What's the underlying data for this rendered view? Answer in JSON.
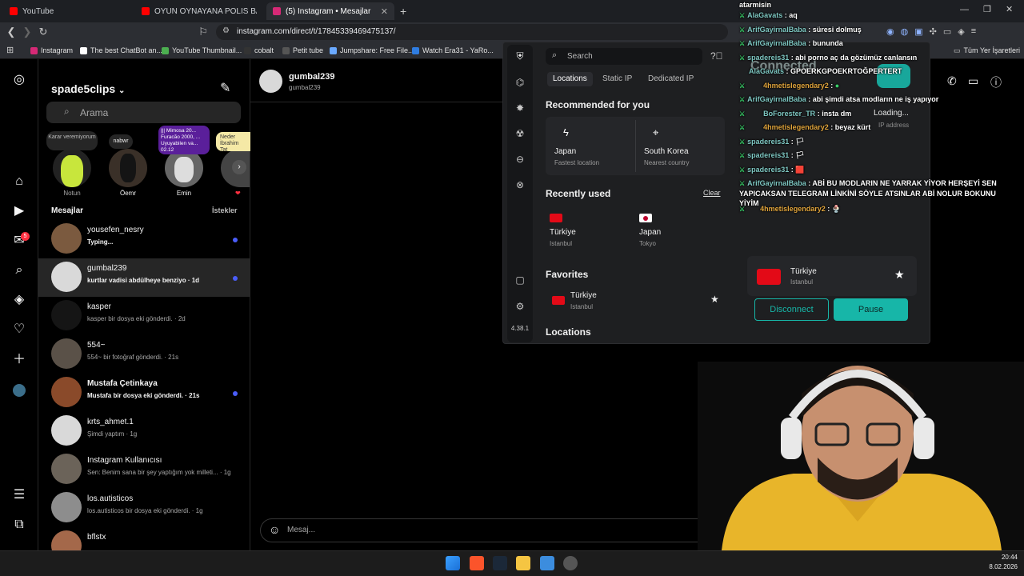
{
  "browser": {
    "tabs": [
      {
        "title": "YouTube",
        "favicon_color": "#ff0000"
      },
      {
        "title": "OYUN OYNAYANA POLİS BASKINI",
        "favicon_color": "#ff0000"
      },
      {
        "title": "(5) Instagram • Mesajlar",
        "favicon_color": "#d62976",
        "active": true
      }
    ],
    "url": "instagram.com/direct/t/17845339469475137/",
    "bookmarks": [
      "Instagram",
      "The best ChatBot an...",
      "YouTube Thumbnail...",
      "cobalt",
      "Petit tube",
      "Jumpshare: Free File...",
      "Watch Era31 - YaRo..."
    ],
    "all_bookmarks": "Tüm Yer İşaretleri"
  },
  "instagram": {
    "username": "spade5clips",
    "search_placeholder": "Arama",
    "notes": [
      {
        "text": "Karar veremiyorum",
        "label": "Notun"
      },
      {
        "text": "nabwr",
        "label": "Öemr"
      },
      {
        "text": "||| Mimosa 20... Furacão 2000, ... Uyuyabilen va... 02.12",
        "label": "Emin"
      },
      {
        "text": "Neder İbrahim Tat",
        "label": ""
      }
    ],
    "messages_title": "Mesajlar",
    "requests_label": "İstekler",
    "notification_count": "5",
    "conversations": [
      {
        "name": "yousefen_nesry",
        "preview": "Typing...",
        "unread": true,
        "bold": true
      },
      {
        "name": "gumbal239",
        "preview": "kurtlar vadisi abdülheye benziyo · 1d",
        "unread": true,
        "bold": true,
        "selected": true
      },
      {
        "name": "kasper",
        "preview": "kasper bir dosya eki gönderdi. · 2d"
      },
      {
        "name": "554~",
        "preview": "554~ bir fotoğraf gönderdi. · 21s"
      },
      {
        "name": "Mustafa Çetinkaya",
        "preview": "Mustafa bir dosya eki gönderdi. · 21s",
        "unread": true,
        "bold": true
      },
      {
        "name": "krts_ahmet.1",
        "preview": "Şimdi yaptım · 1g"
      },
      {
        "name": "Instagram Kullanıcısı",
        "preview": "Sen: Benim sana bir şey yaptığım yok milleti... · 1g"
      },
      {
        "name": "los.autisticos",
        "preview": "los.autisticos bir dosya eki gönderdi. · 1g"
      },
      {
        "name": "bflstx",
        "preview": ""
      }
    ],
    "chat": {
      "name": "gumbal239",
      "handle": "gumbal239",
      "input_placeholder": "Mesaj..."
    }
  },
  "vpn": {
    "search_placeholder": "Search",
    "tabs": [
      "Locations",
      "Static IP",
      "Dedicated IP"
    ],
    "recommended_title": "Recommended for you",
    "recommended": [
      {
        "name": "Japan",
        "sub": "Fastest location"
      },
      {
        "name": "South Korea",
        "sub": "Nearest country"
      }
    ],
    "recent_title": "Recently used",
    "clear_label": "Clear",
    "recent": [
      {
        "name": "Türkiye",
        "city": "Istanbul"
      },
      {
        "name": "Japan",
        "city": "Tokyo"
      }
    ],
    "favorites_title": "Favorites",
    "favorites": [
      {
        "name": "Türkiye",
        "city": "Istanbul"
      }
    ],
    "locations_title": "Locations",
    "version": "4.38.1",
    "status": "Connected",
    "loading": "Loading...",
    "ip_label": "IP address",
    "current": {
      "name": "Türkiye",
      "city": "Istanbul"
    },
    "disconnect_label": "Disconnect",
    "pause_label": "Pause"
  },
  "stream_chat": [
    {
      "user": "",
      "text": "atarmisin"
    },
    {
      "user": "AlaGavats",
      "text": "aq"
    },
    {
      "user": "ArifGayirnalBaba",
      "text": "süresi dolmuş"
    },
    {
      "user": "ArifGayirnalBaba",
      "text": "bununda"
    },
    {
      "user": "spadereis31",
      "text": "abi porno aç da gözümüz canlansın"
    },
    {
      "user": "AlaGavats",
      "text": "GPOERKGPOEKRTOĞPERTERT"
    },
    {
      "user": "4hmetislegendary2",
      "text": "",
      "orange": true
    },
    {
      "user": "ArifGayirnalBaba",
      "text": "abi şimdi atsa modların ne iş yapıyor"
    },
    {
      "user": "BoForester_TR",
      "text": "insta dm"
    },
    {
      "user": "4hmetislegendary2",
      "text": "beyaz kürt",
      "orange": true
    },
    {
      "user": "spadereis31",
      "text": "🏳"
    },
    {
      "user": "spadereis31",
      "text": "🏳"
    },
    {
      "user": "spadereis31",
      "text": "🟥"
    },
    {
      "user": "ArifGayirnalBaba",
      "text": "ABİ BU MODLARIN NE YARRAK YİYOR HERŞEYİ SEN YAPICAKSAN TELEGRAM LİNKİNİ SÖYLE ATSINLAR ABİ NOLUR BOKUNU YİYİM"
    },
    {
      "user": "4hmetislegendary2",
      "text": "🍨",
      "orange": true
    }
  ],
  "taskbar": {
    "time": "20:44",
    "date": "8.02.2026"
  }
}
